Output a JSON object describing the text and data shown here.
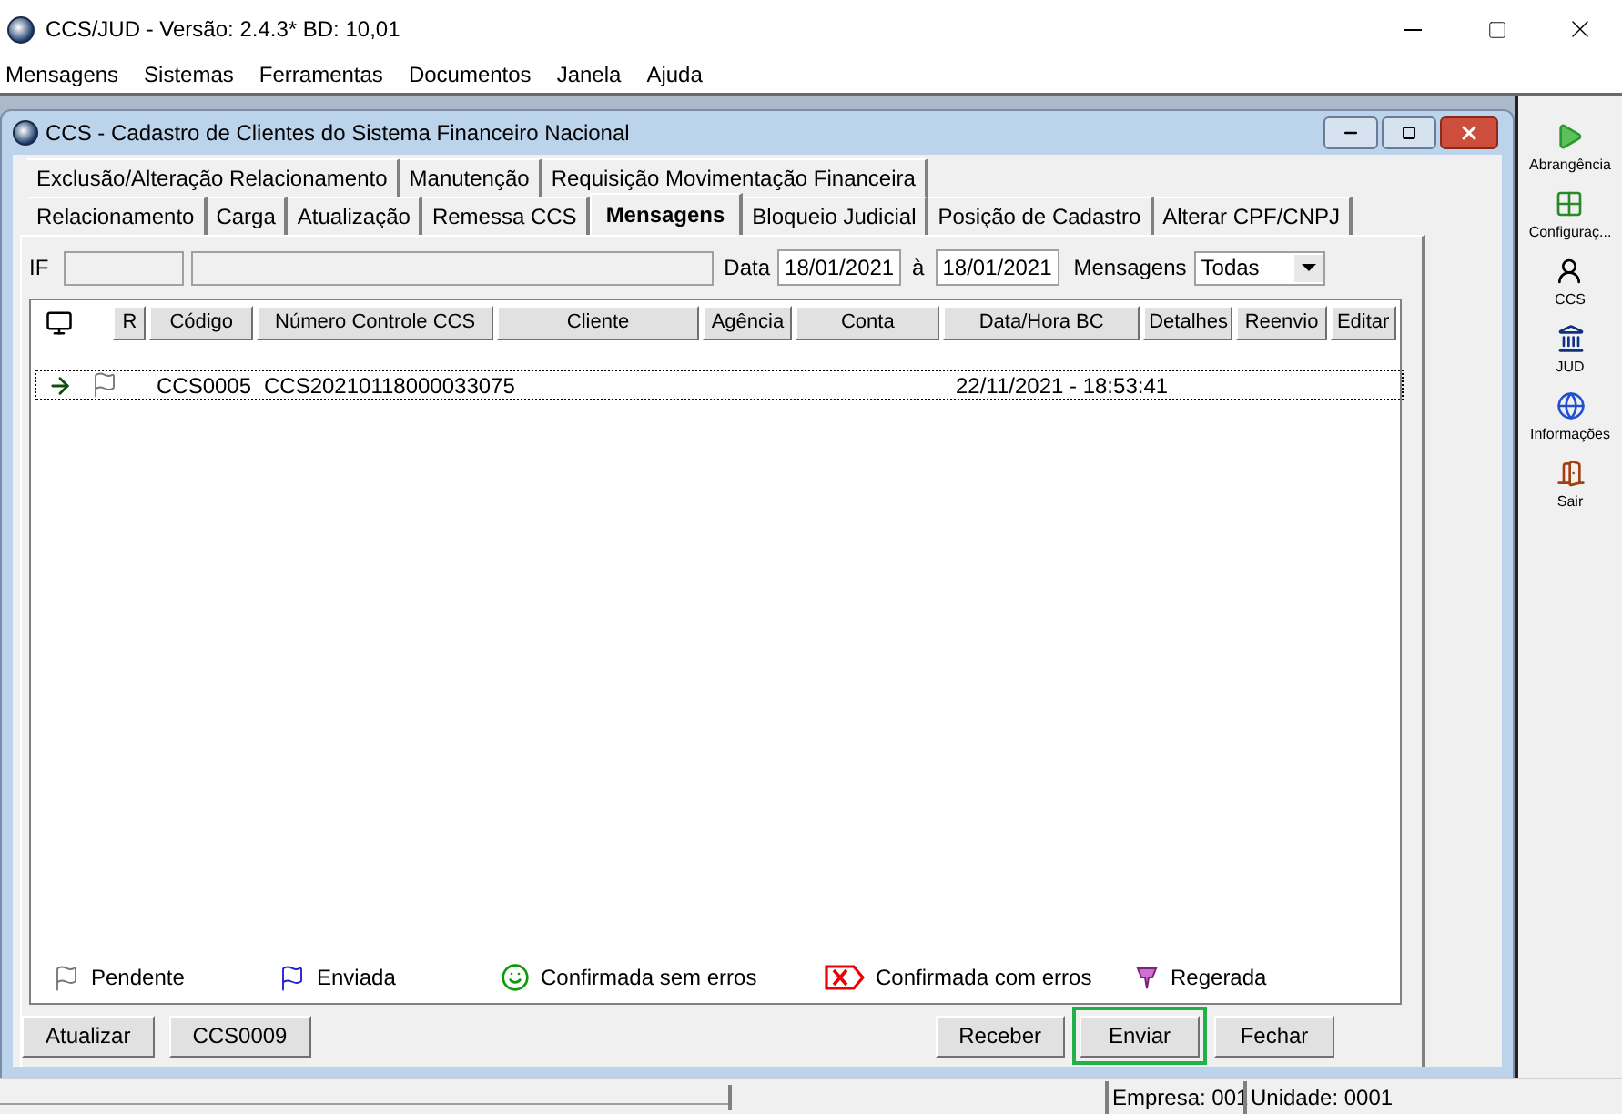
{
  "app_window": {
    "title": "CCS/JUD - Versão: 2.4.3* BD: 10,01"
  },
  "menu": [
    "Mensagens",
    "Sistemas",
    "Ferramentas",
    "Documentos",
    "Janela",
    "Ajuda"
  ],
  "child_window": {
    "title": "CCS - Cadastro de Clientes do Sistema Financeiro Nacional"
  },
  "tab_rows": [
    [
      {
        "label": "Exclusão/Alteração Relacionamento",
        "selected": false
      },
      {
        "label": "Manutenção",
        "selected": false
      },
      {
        "label": "Requisição Movimentação Financeira",
        "selected": false
      }
    ],
    [
      {
        "label": "Relacionamento",
        "selected": false
      },
      {
        "label": "Carga",
        "selected": false
      },
      {
        "label": "Atualização",
        "selected": false
      },
      {
        "label": "Remessa CCS",
        "selected": false
      },
      {
        "label": "Mensagens",
        "selected": true
      },
      {
        "label": "Bloqueio Judicial",
        "selected": false
      },
      {
        "label": "Posição de Cadastro",
        "selected": false
      },
      {
        "label": "Alterar CPF/CNPJ",
        "selected": false
      }
    ]
  ],
  "filter": {
    "if_label": "IF",
    "date_label": "Data",
    "date_from": "18/01/2021",
    "date_sep": "à",
    "date_to": "18/01/2021",
    "messages_label": "Mensagens",
    "messages_value": "Todas"
  },
  "table": {
    "columns": [
      "R",
      "Código",
      "Número Controle CCS",
      "Cliente",
      "Agência",
      "Conta",
      "Data/Hora BC",
      "Detalhes",
      "Reenvio",
      "Editar"
    ],
    "rows": [
      {
        "current": true,
        "kind": "pending",
        "codigo": "CCS0005",
        "numero": "CCS20210118000033075",
        "data_hora": "22/11/2021 - 18:53:41"
      }
    ]
  },
  "legend": [
    {
      "kind": "pending",
      "label": "Pendente"
    },
    {
      "kind": "sent",
      "label": "Enviada"
    },
    {
      "kind": "ok",
      "label": "Confirmada sem erros"
    },
    {
      "kind": "error",
      "label": "Confirmada com erros"
    },
    {
      "kind": "regen",
      "label": "Regerada"
    }
  ],
  "left_buttons": [
    {
      "label": "Atualizar",
      "highlighted": false
    },
    {
      "label": "CCS0009",
      "highlighted": false
    }
  ],
  "right_buttons": [
    {
      "label": "Receber",
      "highlighted": false
    },
    {
      "label": "Enviar",
      "highlighted": true
    },
    {
      "label": "Fechar",
      "highlighted": false
    }
  ],
  "toolbar": [
    {
      "kind": "scope",
      "label": "Abrangência"
    },
    {
      "kind": "config",
      "label": "Configuraç..."
    },
    {
      "kind": "ccs",
      "label": "CCS"
    },
    {
      "kind": "jud",
      "label": "JUD"
    },
    {
      "kind": "info",
      "label": "Informações"
    },
    {
      "kind": "exit",
      "label": "Sair"
    }
  ],
  "status_bar": [
    "Empresa: 001",
    "Unidade: 0001"
  ]
}
